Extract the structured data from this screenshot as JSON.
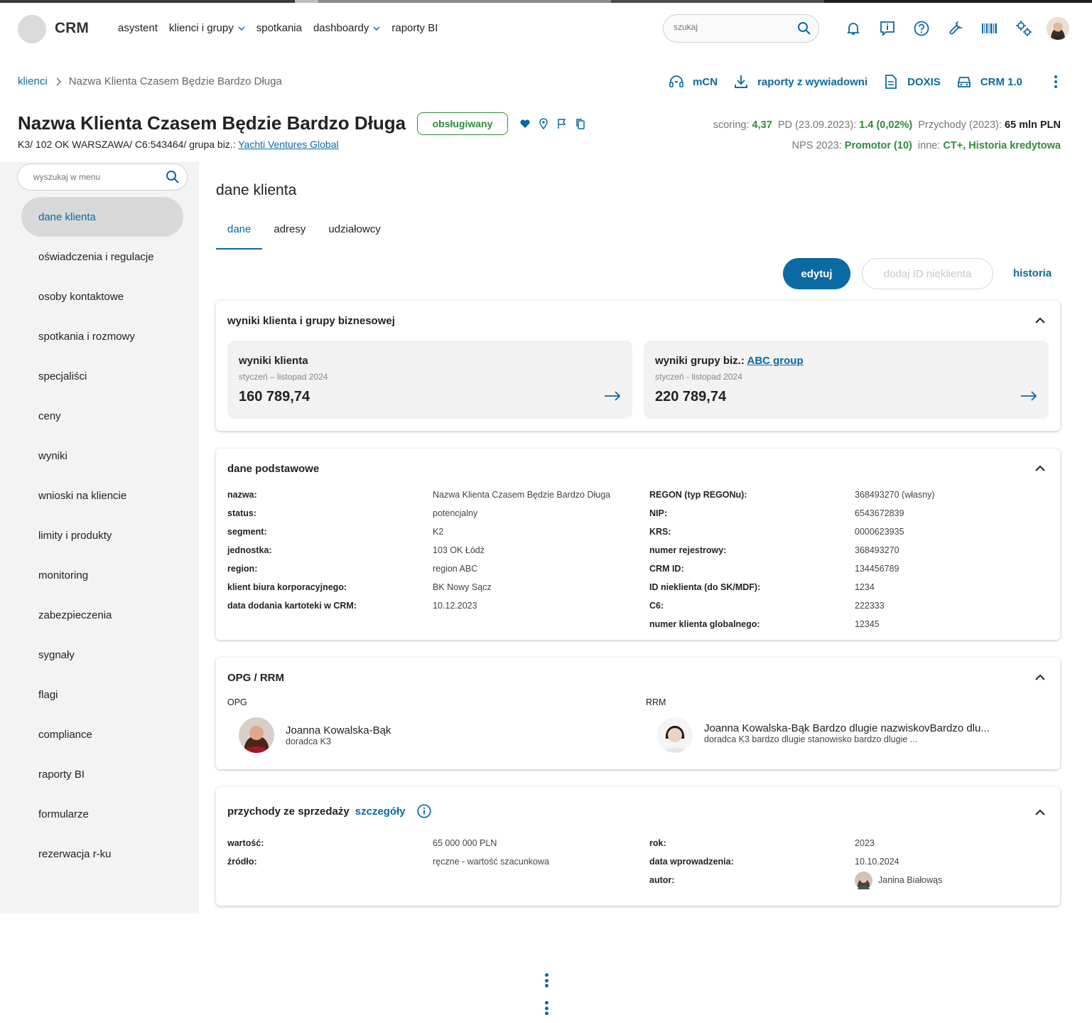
{
  "header": {
    "logo": "CRM",
    "nav": [
      {
        "label": "asystent",
        "dropdown": false
      },
      {
        "label": "klienci i grupy",
        "dropdown": true
      },
      {
        "label": "spotkania",
        "dropdown": false
      },
      {
        "label": "dashboardy",
        "dropdown": true
      },
      {
        "label": "raporty BI",
        "dropdown": false
      }
    ],
    "search_placeholder": "szukaj",
    "icons": [
      "bell-icon",
      "info-message-icon",
      "help-icon",
      "wrench-icon",
      "barcode-icon",
      "settings-icon"
    ]
  },
  "breadcrumb": {
    "root": "klienci",
    "current": "Nazwa Klienta Czasem Będzie Bardzo Długa"
  },
  "actions": [
    {
      "label": "mCN",
      "icon": "headset-icon"
    },
    {
      "label": "raporty z wywiadowni",
      "icon": "download-icon"
    },
    {
      "label": "DOXIS",
      "icon": "document-icon"
    },
    {
      "label": "CRM 1.0",
      "icon": "car-icon"
    }
  ],
  "client": {
    "name": "Nazwa Klienta Czasem Będzie Bardzo Długa",
    "status_badge": "obsługiwany",
    "subtitle_prefix": "K3/ 102 OK WARSZAWA/ C6:543464/ grupa biz.:",
    "group_link": "Yachti Ventures Global"
  },
  "metrics": {
    "scoring_label": "scoring:",
    "scoring_value": "4,37",
    "pd_label": "PD (23.09.2023):",
    "pd_value": "1.4 (0,02%)",
    "revenue_label": "Przychody (2023):",
    "revenue_value": "65 mln PLN",
    "nps_label": "NPS 2023:",
    "nps_value": "Promotor (10)",
    "other_label": "inne:",
    "other_value": "CT+, Historia kredytowa"
  },
  "sidebar": {
    "search_placeholder": "wyszukaj w menu",
    "items": [
      "dane klienta",
      "oświadczenia i regulacje",
      "osoby kontaktowe",
      "spotkania i rozmowy",
      "specjaliści",
      "ceny",
      "wyniki",
      "wnioski na kliencie",
      "limity i produkty",
      "monitoring",
      "zabezpieczenia",
      "sygnały",
      "flagi",
      "compliance",
      "raporty BI",
      "formularze",
      "rezerwacja r-ku"
    ],
    "active_index": 0
  },
  "main": {
    "title": "dane klienta",
    "tabs": [
      "dane",
      "adresy",
      "udziałowcy"
    ],
    "active_tab": 0,
    "buttons": {
      "edit": "edytuj",
      "add_id": "dodaj ID nieklienta",
      "history": "historia"
    },
    "results": {
      "title": "wyniki klienta i grupy biznesowej",
      "client": {
        "title": "wyniki klienta",
        "period": "styczeń – listopad 2024",
        "value": "160 789,74"
      },
      "group": {
        "title_prefix": "wyniki grupy biz.:",
        "link": "ABC group",
        "period": "styczeń - listopad 2024",
        "value": "220 789,74"
      }
    },
    "basic": {
      "title": "dane podstawowe",
      "left": [
        {
          "k": "nazwa:",
          "v": "Nazwa Klienta Czasem Będzie Bardzo Długa"
        },
        {
          "k": "status:",
          "v": "potencjalny"
        },
        {
          "k": "segment:",
          "v": "K2"
        },
        {
          "k": "jednostka:",
          "v": "103 OK Łódź"
        },
        {
          "k": "region:",
          "v": "region ABC"
        },
        {
          "k": "klient biura korporacyjnego:",
          "v": "BK Nowy Sącz"
        },
        {
          "k": "data dodania kartoteki w CRM:",
          "v": "10.12.2023"
        }
      ],
      "right": [
        {
          "k": "REGON (typ REGONu):",
          "v": "368493270 (własny)"
        },
        {
          "k": "NIP:",
          "v": "6543672839"
        },
        {
          "k": "KRS:",
          "v": "0000623935"
        },
        {
          "k": "numer rejestrowy:",
          "v": "368493270"
        },
        {
          "k": "CRM ID:",
          "v": "134456789"
        },
        {
          "k": "ID nieklienta (do SK/MDF):",
          "v": "1234"
        },
        {
          "k": "C6:",
          "v": "222333"
        },
        {
          "k": "numer klienta globalnego:",
          "v": "12345"
        }
      ]
    },
    "opg": {
      "title": "OPG / RRM",
      "opg_label": "OPG",
      "opg_name": "Joanna Kowalska-Bąk",
      "opg_role": "doradca K3",
      "rrm_label": "RRM",
      "rrm_name": "Joanna Kowalska-Bąk Bardzo dlugie nazwiskovBardzo dlu...",
      "rrm_role": "doradca K3 bardzo dlugie stanowisko bardzo dlugie ..."
    },
    "revenue": {
      "title": "przychody ze sprzedaży",
      "details_link": "szczegóły",
      "left": [
        {
          "k": "wartość:",
          "v": "65 000 000 PLN"
        },
        {
          "k": "źródło:",
          "v": "ręczne - wartość szacunkowa"
        }
      ],
      "right": [
        {
          "k": "rok:",
          "v": "2023"
        },
        {
          "k": "data wprowadzenia:",
          "v": "10.10.2024"
        },
        {
          "k": "autor:",
          "v": "Janina Białowąs"
        }
      ]
    }
  },
  "colors": {
    "accent": "#0a6aa1",
    "success": "#2e8b3a",
    "sidebar_bg": "#f3f3f3"
  }
}
